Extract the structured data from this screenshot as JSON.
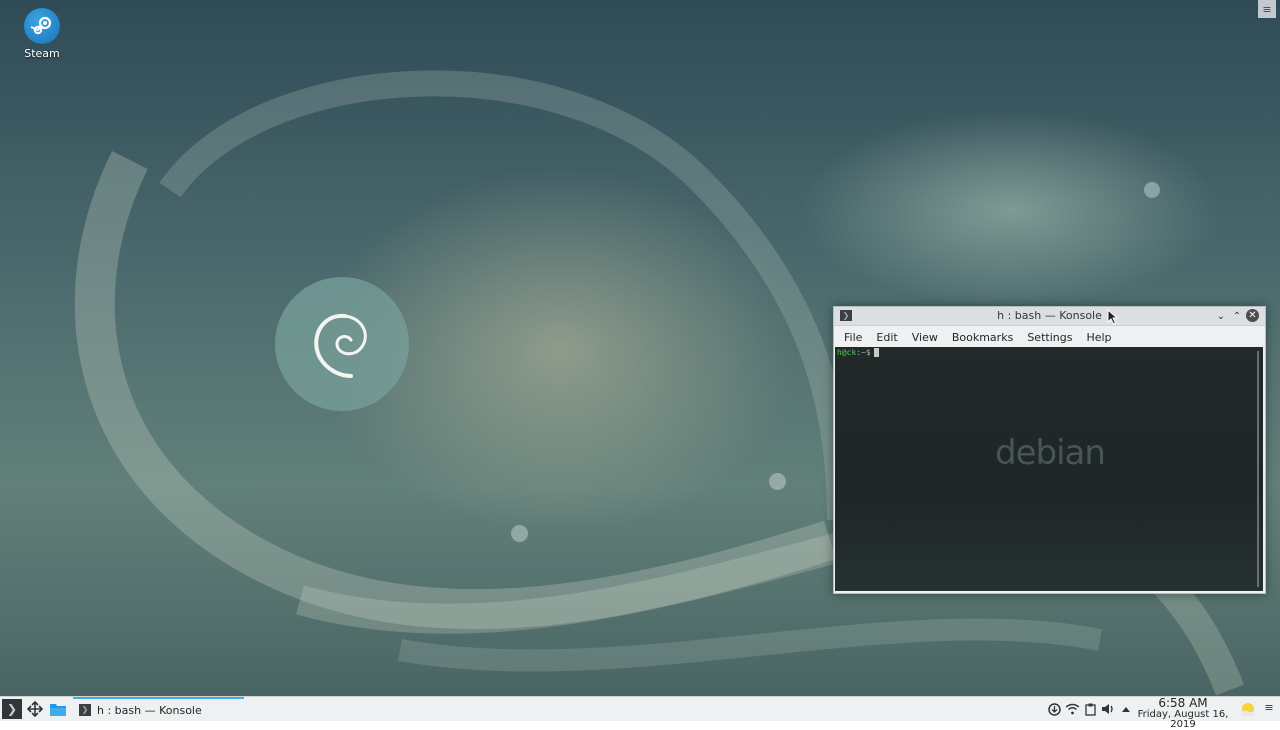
{
  "desktop": {
    "icons": [
      {
        "label": "Steam",
        "icon": "steam-icon"
      }
    ],
    "menu_glyph": "≡"
  },
  "konsole": {
    "title": "h : bash — Konsole",
    "menu": [
      "File",
      "Edit",
      "View",
      "Bookmarks",
      "Settings",
      "Help"
    ],
    "prompt_user": "h@ck",
    "prompt_path": ":~$",
    "watermark": "debian",
    "buttons": {
      "minimize": "⌄",
      "maximize": "⌃",
      "close": "✕"
    }
  },
  "taskbar": {
    "launcher_glyph": "❯",
    "tasks": [
      {
        "label": "h : bash — Konsole",
        "icon": "terminal-icon"
      }
    ],
    "tray_icons": [
      "updates-icon",
      "wifi-icon",
      "volume-icon",
      "clipboard-icon",
      "expand-tray-icon"
    ],
    "clock": {
      "time": "6:58 AM",
      "date": "Friday, August 16, 2019"
    },
    "settings_glyph": "≡"
  },
  "colors": {
    "accent": "#3daee9",
    "prompt_green": "#4ec955",
    "panel_bg": "#eff0f1",
    "terminal_bg": "#222929"
  }
}
